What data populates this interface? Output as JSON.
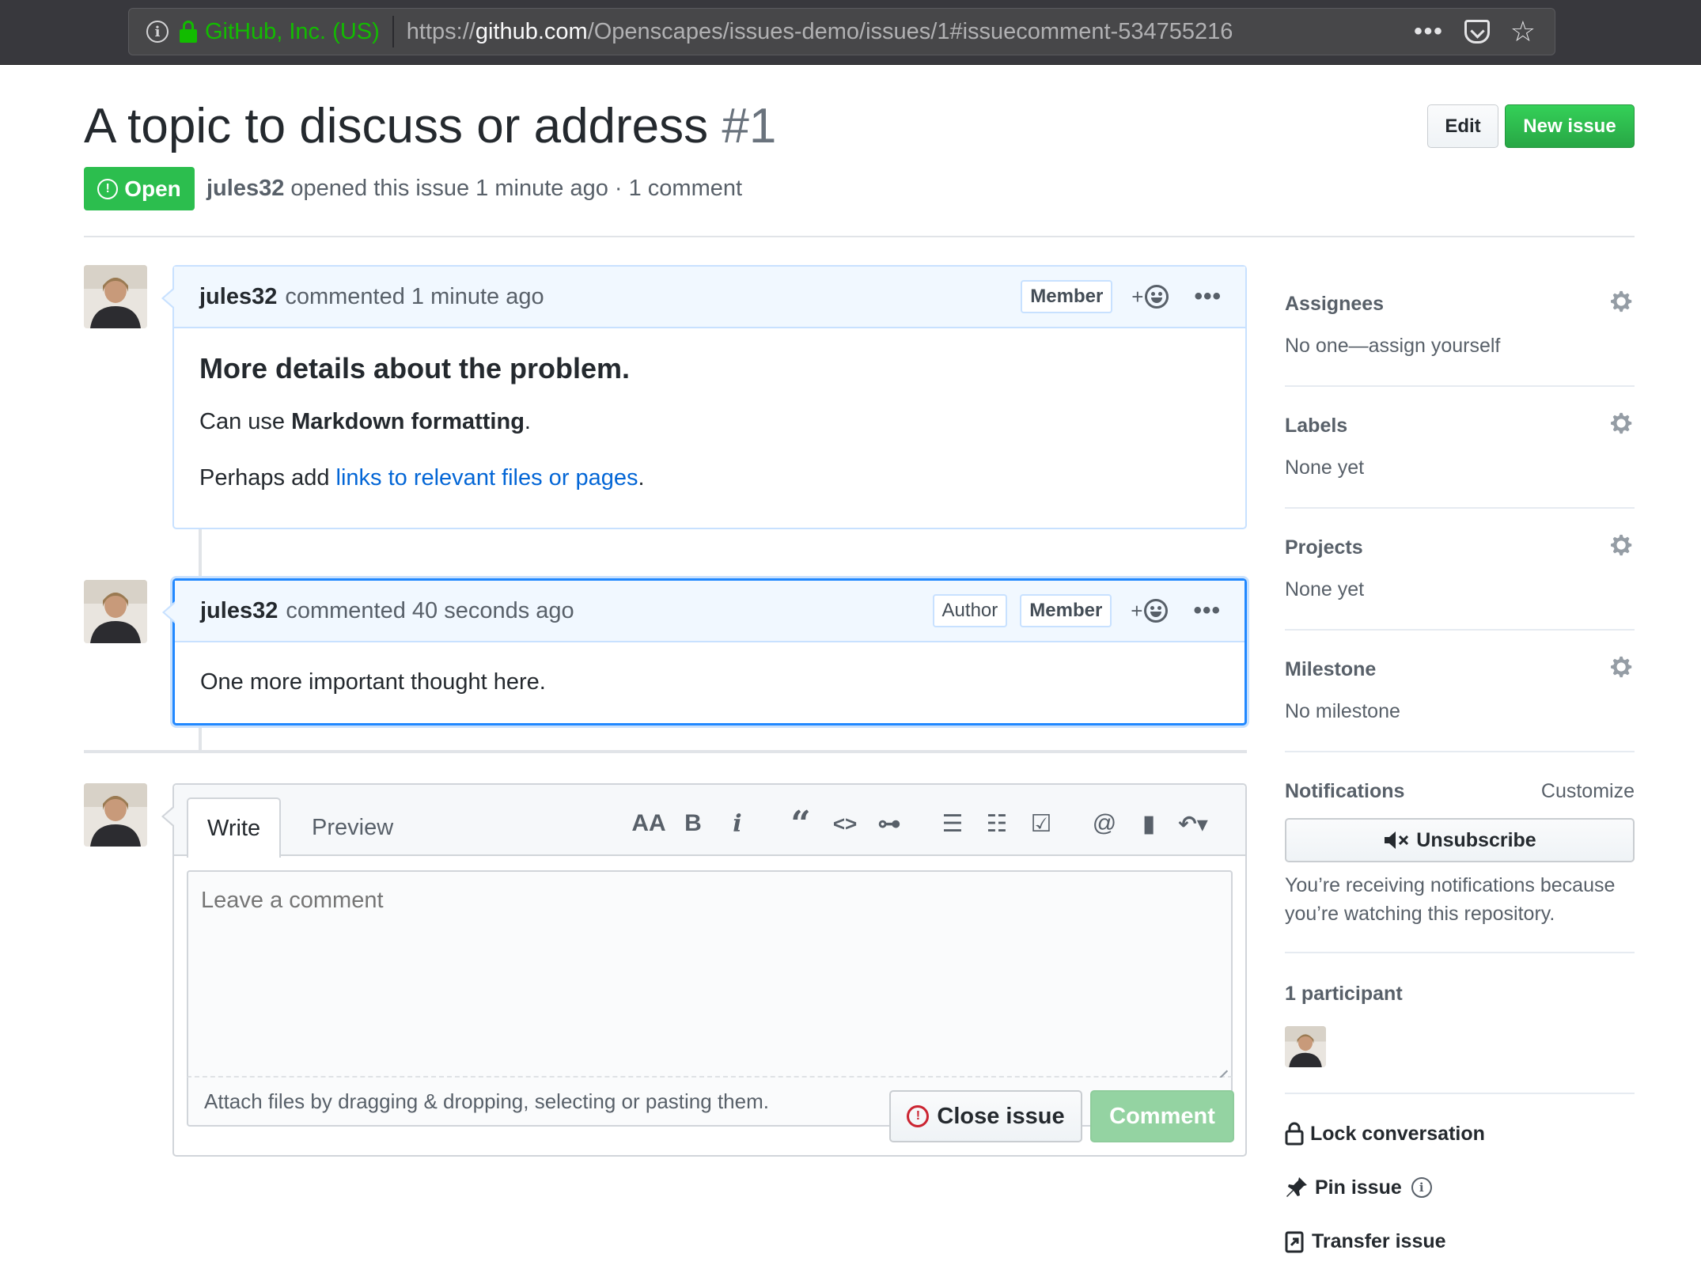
{
  "browser": {
    "org": "GitHub, Inc. (US)",
    "url_prefix": "https://",
    "url_host": "github.com",
    "url_path": "/Openscapes/issues-demo/issues/1#issuecomment-534755216",
    "menu_icon": "ellipsis-icon",
    "pocket_icon": "pocket-icon",
    "bookmark_icon": "star-icon"
  },
  "issue": {
    "title": "A topic to discuss or address",
    "number": "#1",
    "state": "Open",
    "author": "jules32",
    "meta_text": "opened this issue 1 minute ago · 1 comment",
    "edit_label": "Edit",
    "new_issue_label": "New issue"
  },
  "comments": [
    {
      "author": "jules32",
      "action": "commented 1 minute ago",
      "badges": [
        "Member"
      ],
      "heading": "More details about the problem.",
      "line1_prefix": "Can use ",
      "line1_bold": "Markdown formatting",
      "line1_suffix": ".",
      "line2_prefix": "Perhaps add ",
      "line2_link": "links to relevant files or pages",
      "line2_suffix": "."
    },
    {
      "author": "jules32",
      "action": "commented 40 seconds ago",
      "badges": [
        "Author",
        "Member"
      ],
      "text": "One more important thought here."
    }
  ],
  "reaction_plus": "+",
  "composer": {
    "tab_write": "Write",
    "tab_preview": "Preview",
    "placeholder": "Leave a comment",
    "drop_text": "Attach files by dragging & dropping, selecting or pasting them.",
    "close_label": "Close issue",
    "comment_label": "Comment",
    "tools": {
      "heading": "AA",
      "bold": "B",
      "italic": "i",
      "quote": "“",
      "code": "<>",
      "link": "⊶",
      "ul": "☰",
      "ol": "☷",
      "task": "☑",
      "mention": "@",
      "saved": "▮",
      "reply": "↶▾"
    }
  },
  "sidebar": {
    "assignees_title": "Assignees",
    "assignees_value": "No one—assign yourself",
    "labels_title": "Labels",
    "labels_value": "None yet",
    "projects_title": "Projects",
    "projects_value": "None yet",
    "milestone_title": "Milestone",
    "milestone_value": "No milestone",
    "notifications_title": "Notifications",
    "customize": "Customize",
    "unsubscribe": "Unsubscribe",
    "notif_reason": "You’re receiving notifications because you’re watching this repository.",
    "participants": "1 participant",
    "lock": "Lock conversation",
    "pin": "Pin issue",
    "transfer": "Transfer issue"
  },
  "colors": {
    "green": "#2cbe4e",
    "link": "#0366d6",
    "active_border": "#2188ff",
    "header_bg": "#f1f8ff"
  }
}
